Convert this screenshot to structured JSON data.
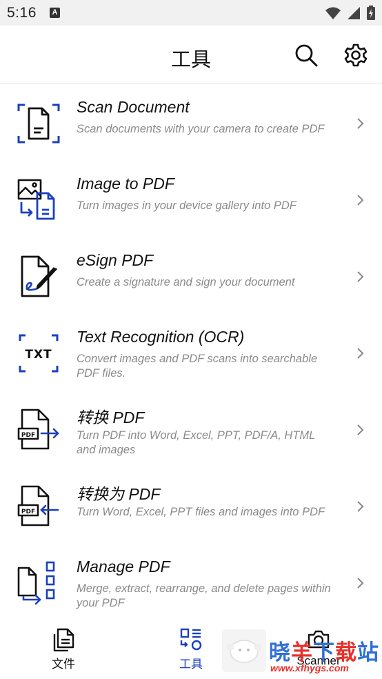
{
  "status_bar": {
    "time": "5:16",
    "notification_badge": "A",
    "icons": [
      "wifi-icon",
      "cell-signal-icon",
      "battery-icon"
    ]
  },
  "app_bar": {
    "title": "工具",
    "search_icon": "search-icon",
    "settings_icon": "gear-icon"
  },
  "tools": [
    {
      "title": "Scan Document",
      "desc": "Scan documents with your camera to create PDF",
      "icon": "scan-document-icon"
    },
    {
      "title": "Image to PDF",
      "desc": "Turn images in your device gallery into PDF",
      "icon": "image-to-pdf-icon"
    },
    {
      "title": "eSign PDF",
      "desc": "Create a signature and sign your document",
      "icon": "esign-icon"
    },
    {
      "title": "Text Recognition (OCR)",
      "desc": "Convert images and PDF scans into searchable PDF files.",
      "icon": "ocr-icon"
    },
    {
      "title": "转换 PDF",
      "desc": "Turn PDF into Word, Excel, PPT, PDF/A, HTML and images",
      "icon": "convert-from-pdf-icon"
    },
    {
      "title": "转换为 PDF",
      "desc": "Turn Word, Excel, PPT files and images into PDF",
      "icon": "convert-to-pdf-icon"
    },
    {
      "title": "Manage PDF",
      "desc": "Merge, extract, rearrange, and delete pages within your PDF",
      "icon": "manage-pdf-icon"
    }
  ],
  "bottom_nav": {
    "files_label": "文件",
    "tools_label": "工具",
    "scanner_label": "Scanner",
    "active": "tools"
  },
  "watermark": {
    "text": "晓羊下载站",
    "url": "www.xfhygs.com"
  },
  "colors": {
    "accent": "#1a3fbf",
    "muted_text": "#8a8a8a",
    "watermark_red": "#e8302a",
    "watermark_blue": "#2f6fd6"
  }
}
